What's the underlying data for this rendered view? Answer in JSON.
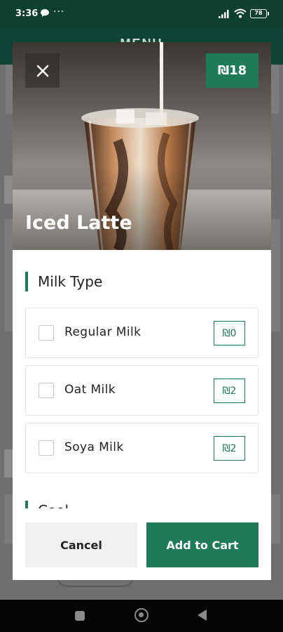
{
  "status_bar": {
    "time": "3:36",
    "dots": "···",
    "battery": "78"
  },
  "background": {
    "menu_title": "MENU"
  },
  "modal": {
    "title": "Iced Latte",
    "price": "₪18",
    "section_title": "Milk Type",
    "next_section_title": "Cool...",
    "options": [
      {
        "label": "Regular Milk",
        "price": "₪0",
        "checked": false
      },
      {
        "label": "Oat Milk",
        "price": "₪2",
        "checked": false
      },
      {
        "label": "Soya Milk",
        "price": "₪2",
        "checked": false
      }
    ],
    "cancel_label": "Cancel",
    "add_label": "Add to Cart"
  },
  "colors": {
    "brand": "#1f7a5a",
    "header": "#0e3f2f"
  }
}
